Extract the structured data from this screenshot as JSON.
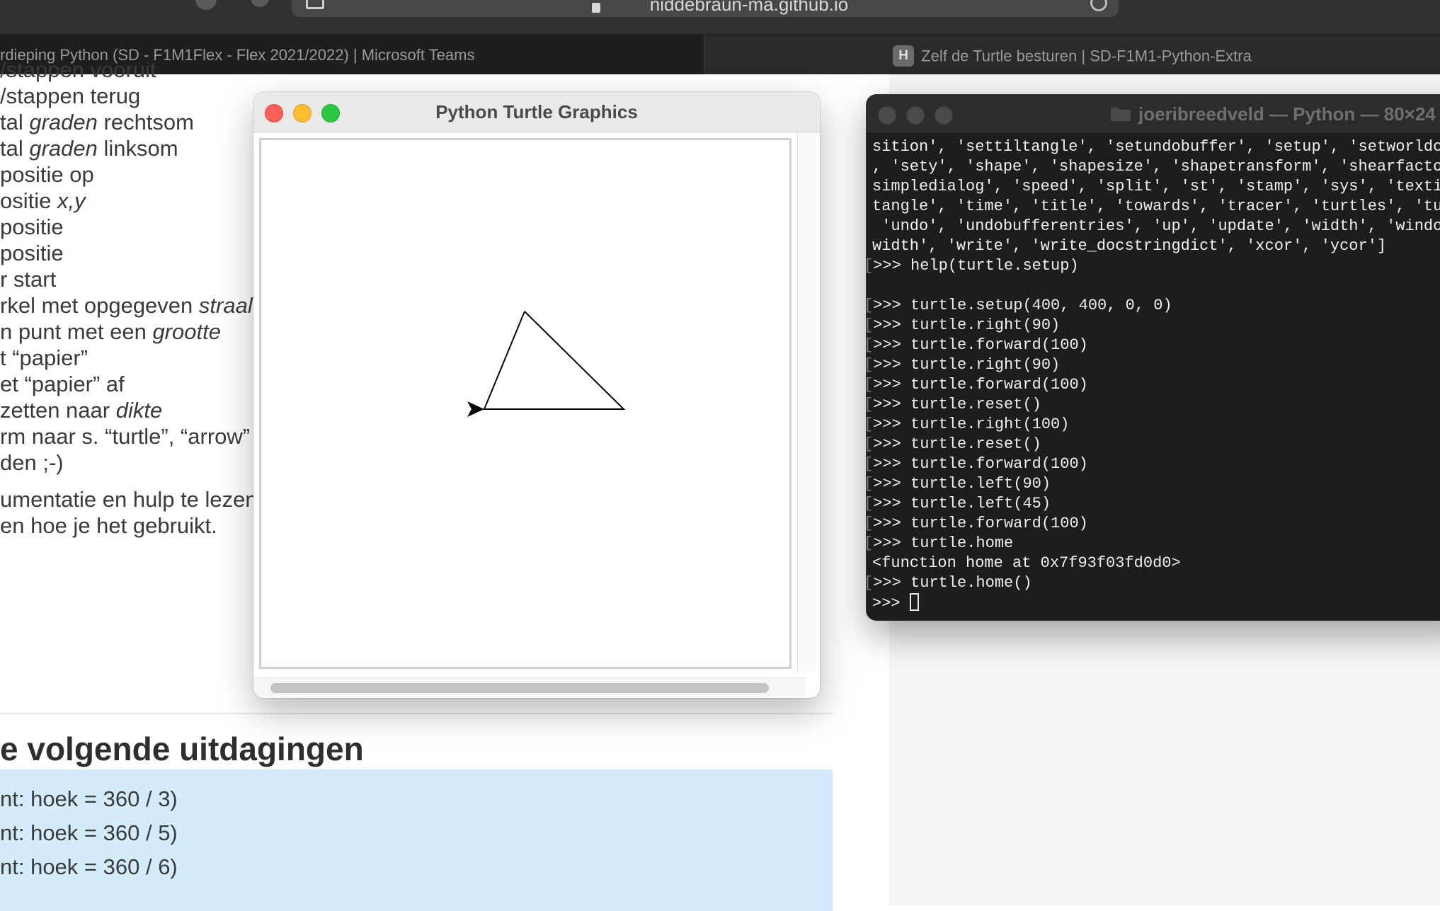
{
  "browser": {
    "address": "niddebraun-ma.github.io",
    "tabs": [
      {
        "label": "rdieping Python (SD - F1M1Flex - Flex 2021/2022) | Microsoft Teams"
      },
      {
        "favicon_letter": "H",
        "label": "Zelf de Turtle besturen | SD-F1M1-Python-Extra"
      }
    ]
  },
  "doc": {
    "lines": [
      {
        "pre": "/stappen vooruit",
        "em": "",
        "post": ""
      },
      {
        "pre": "/stappen terug",
        "em": "",
        "post": ""
      },
      {
        "pre": "tal ",
        "em": "graden",
        "post": " rechtsom"
      },
      {
        "pre": "tal ",
        "em": "graden",
        "post": " linksom"
      },
      {
        "pre": "positie op",
        "em": "",
        "post": ""
      },
      {
        "pre": "ositie ",
        "em": "x,y",
        "post": ""
      },
      {
        "pre": "positie",
        "em": "",
        "post": ""
      },
      {
        "pre": "positie",
        "em": "",
        "post": ""
      },
      {
        "pre": "r start",
        "em": "",
        "post": ""
      },
      {
        "pre": "rkel met opgegeven ",
        "em": "straal",
        "post": ""
      },
      {
        "pre": "n punt met een ",
        "em": "grootte",
        "post": ""
      },
      {
        "pre": "t “papier”",
        "em": "",
        "post": ""
      },
      {
        "pre": "et “papier” af",
        "em": "",
        "post": ""
      },
      {
        "pre": "zetten naar ",
        "em": "dikte",
        "post": ""
      },
      {
        "pre": "rm naar s. “turtle”, “arrow” ,",
        "em": "",
        "post": ""
      },
      {
        "pre": "den ;-)",
        "em": "",
        "post": ""
      },
      {
        "pre": "umentatie en hulp te lezen",
        "em": "",
        "post": ""
      },
      {
        "pre": "en hoe je het gebruikt.",
        "em": "",
        "post": ""
      }
    ],
    "heading": "e volgende uitdagingen",
    "tips": [
      "nt: hoek = 360 / 3)",
      "nt: hoek = 360 / 5)",
      "nt: hoek = 360 / 6)"
    ]
  },
  "turtle_window": {
    "title": "Python Turtle Graphics"
  },
  "terminal": {
    "title": "joeribreedveld — Python — 80×24",
    "lines": [
      {
        "prompt": false,
        "text": "sition', 'settiltangle', 'setundobuffer', 'setup', 'setworldcoordinates'"
      },
      {
        "prompt": false,
        "text": ", 'sety', 'shape', 'shapesize', 'shapetransform', 'shearfactor'"
      },
      {
        "prompt": false,
        "text": "simpledialog', 'speed', 'split', 'st', 'stamp', 'sys', 'textinput'"
      },
      {
        "prompt": false,
        "text": "tangle', 'time', 'title', 'towards', 'tracer', 'turtles', 'turtlesize'"
      },
      {
        "prompt": false,
        "text": " 'undo', 'undobufferentries', 'up', 'update', 'width', 'window_height'"
      },
      {
        "prompt": false,
        "text": "width', 'write', 'write_docstringdict', 'xcor', 'ycor']"
      },
      {
        "prompt": true,
        "text": "help(turtle.setup)"
      },
      {
        "prompt": false,
        "text": ""
      },
      {
        "prompt": true,
        "text": "turtle.setup(400, 400, 0, 0)"
      },
      {
        "prompt": true,
        "text": "turtle.right(90)"
      },
      {
        "prompt": true,
        "text": "turtle.forward(100)"
      },
      {
        "prompt": true,
        "text": "turtle.right(90)"
      },
      {
        "prompt": true,
        "text": "turtle.forward(100)"
      },
      {
        "prompt": true,
        "text": "turtle.reset()"
      },
      {
        "prompt": true,
        "text": "turtle.right(100)"
      },
      {
        "prompt": true,
        "text": "turtle.reset()"
      },
      {
        "prompt": true,
        "text": "turtle.forward(100)"
      },
      {
        "prompt": true,
        "text": "turtle.left(90)"
      },
      {
        "prompt": true,
        "text": "turtle.left(45)"
      },
      {
        "prompt": true,
        "text": "turtle.forward(100)"
      },
      {
        "prompt": true,
        "text": "turtle.home"
      },
      {
        "prompt": false,
        "text": "<function home at 0x7f93f03fd0d0>"
      },
      {
        "prompt": true,
        "text": "turtle.home()"
      }
    ],
    "prompt_symbol": ">>> ",
    "prompt_bracket": "["
  }
}
